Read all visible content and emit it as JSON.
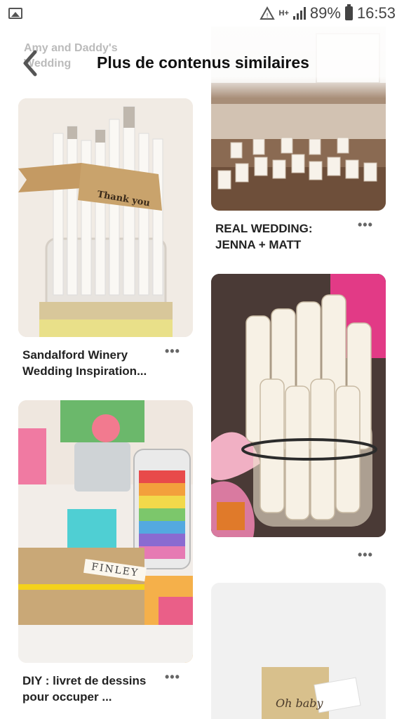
{
  "status_bar": {
    "battery_percent": "89%",
    "time": "16:53",
    "network_type": "H+",
    "icons": [
      "gallery-icon",
      "recycle-alert-icon",
      "signal-icon",
      "battery-icon"
    ]
  },
  "header": {
    "title": "Plus de contenus similaires",
    "back_icon": "chevron-left-icon",
    "ghost_pin_title": "Amy and Daddy's\nWedding"
  },
  "pins": [
    {
      "title": "Sandalford Winery\nWedding Inspiration...",
      "image_label": "Thank you",
      "more_label": "•••"
    },
    {
      "title": "REAL WEDDING:\nJENNA + MATT",
      "more_label": "•••"
    },
    {
      "title": "DIY : livret de dessins\npour occuper ...",
      "image_label": "FINLEY",
      "more_label": "•••"
    },
    {
      "title": "",
      "more_label": "•••"
    },
    {
      "title": "",
      "image_label": "Oh baby",
      "more_label": ""
    }
  ],
  "colors": {
    "background": "#ffffff",
    "text": "#222222",
    "muted": "#666666"
  }
}
